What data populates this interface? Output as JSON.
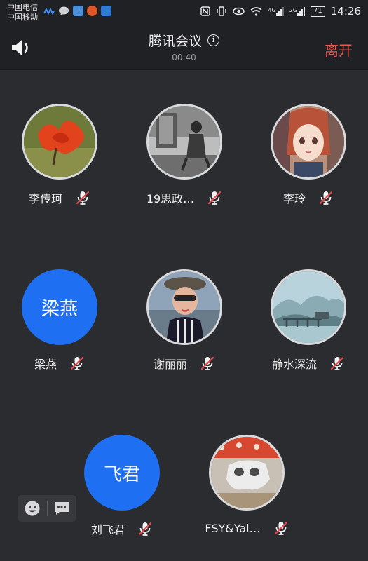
{
  "status_bar": {
    "carrier_1": "中国电信",
    "carrier_2": "中国移动",
    "net_4g": "4G",
    "net_2g": "2G",
    "battery": "71",
    "time": "14:26"
  },
  "header": {
    "title": "腾讯会议",
    "timer": "00:40",
    "leave_label": "离开",
    "info_icon": "i"
  },
  "participants": [
    {
      "name": "李传珂",
      "avatar_type": "photo-flower",
      "muted": true
    },
    {
      "name": "19思政…",
      "avatar_type": "photo-bw",
      "muted": true
    },
    {
      "name": "李玲",
      "avatar_type": "photo-anime",
      "muted": true
    },
    {
      "name": "梁燕",
      "avatar_type": "text",
      "avatar_text": "梁燕",
      "muted": true
    },
    {
      "name": "谢丽丽",
      "avatar_type": "photo-woman",
      "muted": true
    },
    {
      "name": "静水深流",
      "avatar_type": "photo-landscape",
      "muted": true
    },
    {
      "name": "刘飞君",
      "avatar_type": "text",
      "avatar_text": "飞君",
      "muted": true
    },
    {
      "name": "FSY&Yal…",
      "avatar_type": "photo-mask",
      "muted": true
    }
  ],
  "colors": {
    "background": "#2b2c2f",
    "header": "#202124",
    "accent_blue": "#1f6ff2",
    "leave_red": "#f0574a",
    "mute_red": "#e5484d"
  },
  "tools": [
    "emoji-icon",
    "chat-icon"
  ]
}
